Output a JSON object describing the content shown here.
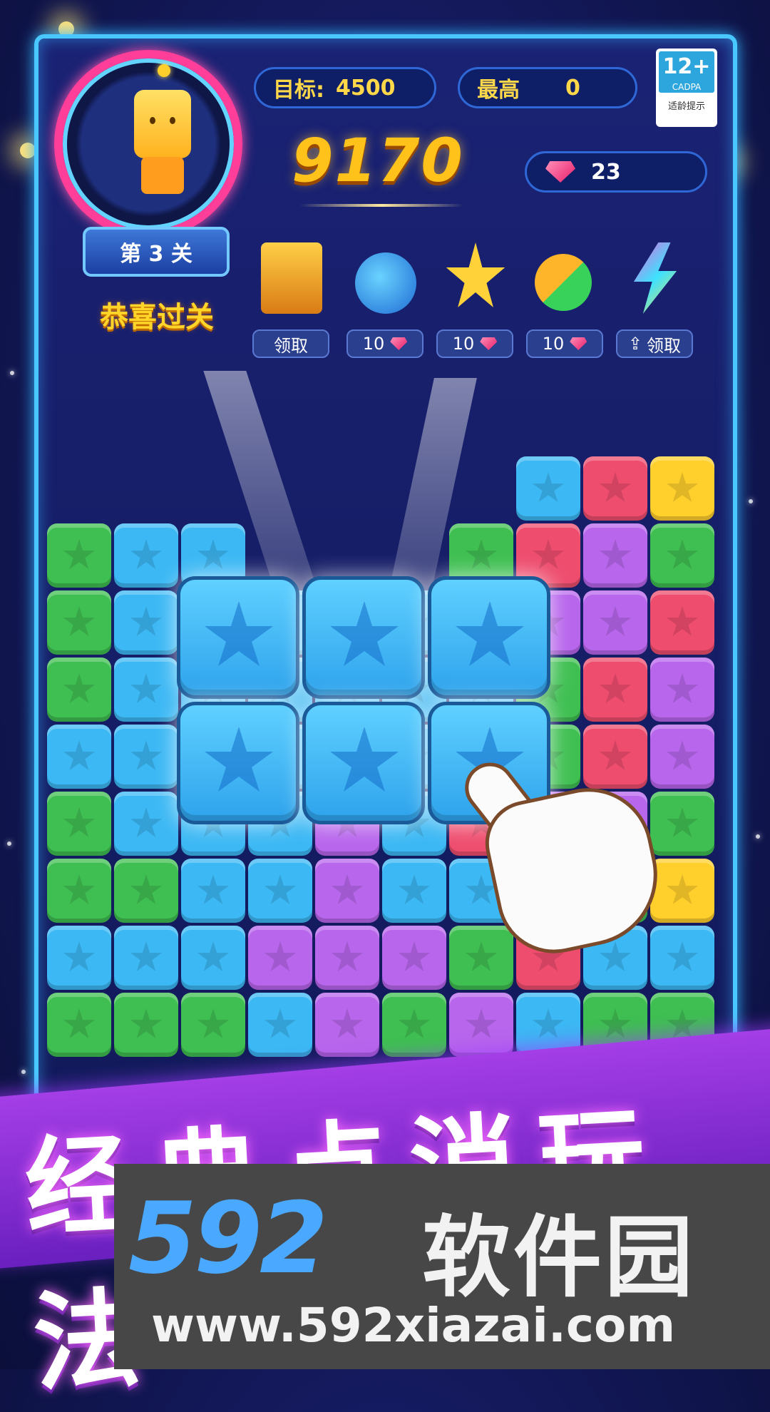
{
  "level": {
    "text": "第 3 关",
    "status": "恭喜过关"
  },
  "target": {
    "label": "目标:",
    "value": "4500"
  },
  "best": {
    "label": "最高",
    "value": "0"
  },
  "score": "9170",
  "gems": "23",
  "age_rating": {
    "age": "12+",
    "org": "CADPA",
    "note": "适龄提示"
  },
  "tools": [
    {
      "icon": "treasure-chest-icon",
      "label": "领取"
    },
    {
      "icon": "bomb-icon",
      "label": "10"
    },
    {
      "icon": "magic-star-icon",
      "label": "10"
    },
    {
      "icon": "swap-icon",
      "label": "10"
    },
    {
      "icon": "rainbow-lightning-icon",
      "label": "领取"
    }
  ],
  "banner": "经典点消玩法",
  "watermark": {
    "logo": "592",
    "name": "软件园",
    "url": "www.592xiazai.com"
  },
  "colors": {
    "blue": "#3cb8f4",
    "green": "#3fbf52",
    "red": "#ee4d6e",
    "yellow": "#ffcf2c",
    "purple": "#b866ec",
    "pink": "#f0608a"
  },
  "board": {
    "rows": [
      [
        ".",
        ".",
        ".",
        ".",
        ".",
        ".",
        ".",
        "B",
        "R",
        "Y"
      ],
      [
        "G",
        "B",
        "B",
        ".",
        ".",
        ".",
        "G",
        "R",
        "P",
        "G"
      ],
      [
        "G",
        "B",
        "B",
        "B",
        "B",
        "B",
        "B",
        "P",
        "P",
        "R"
      ],
      [
        "G",
        "B",
        "B",
        "B",
        "B",
        "B",
        "B",
        "G",
        "R",
        "P"
      ],
      [
        "B",
        "B",
        "B",
        "B",
        "B",
        "B",
        "B",
        "G",
        "R",
        "P"
      ],
      [
        "G",
        "B",
        "B",
        "B",
        "P",
        "B",
        "R",
        "P",
        "P",
        "G"
      ],
      [
        "G",
        "G",
        "B",
        "B",
        "P",
        "B",
        "B",
        "G",
        "G",
        "Y"
      ],
      [
        "B",
        "B",
        "B",
        "P",
        "P",
        "P",
        "G",
        "R",
        "B",
        "B"
      ],
      [
        "G",
        "G",
        "G",
        "B",
        "P",
        "G",
        "P",
        "B",
        "G",
        "G"
      ]
    ]
  }
}
